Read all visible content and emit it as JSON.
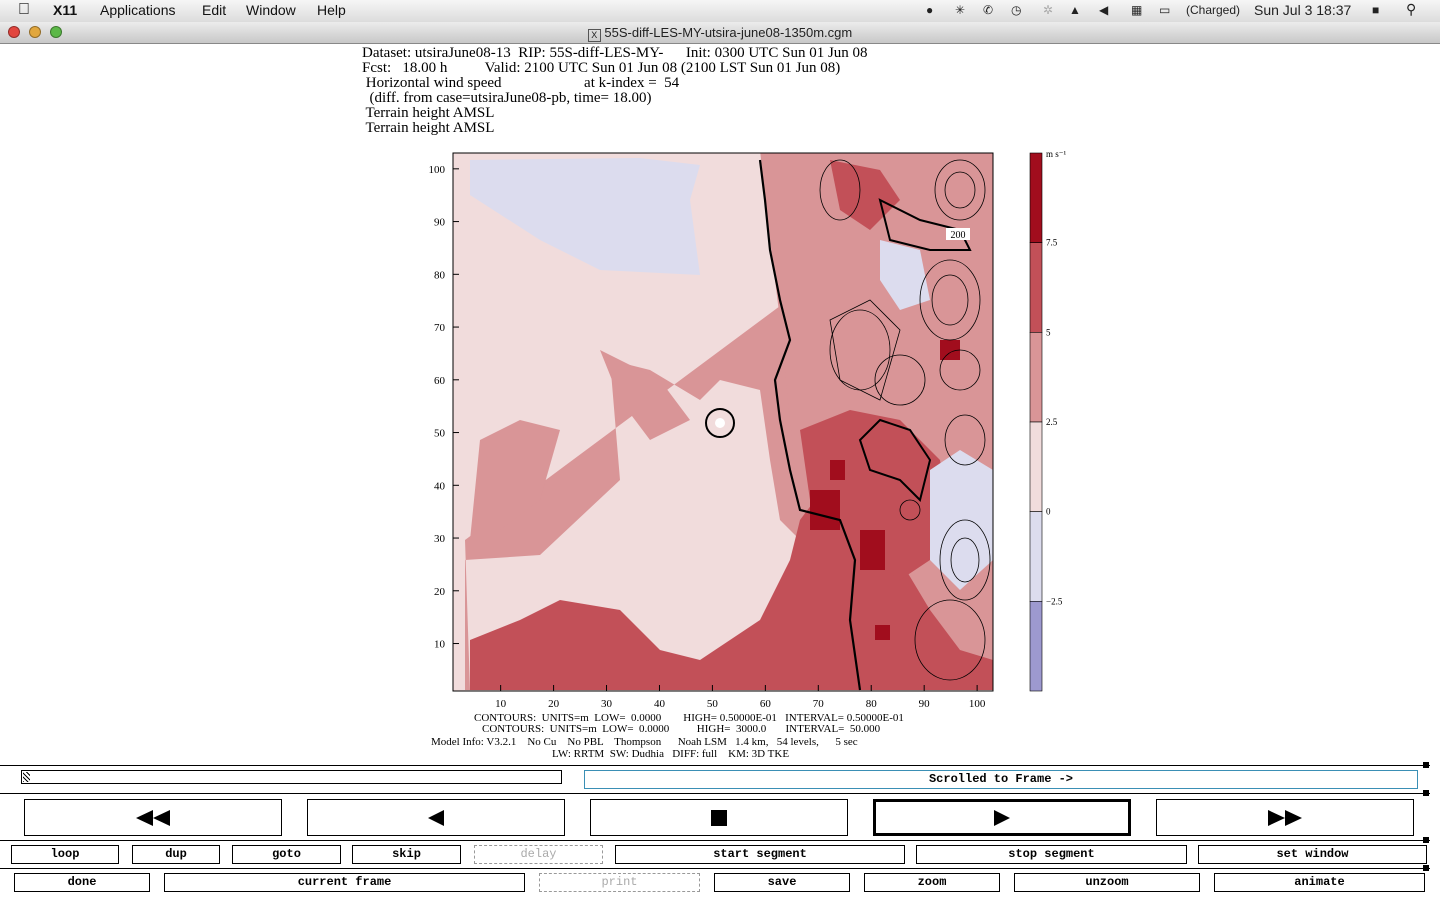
{
  "menubar": {
    "app": "X11",
    "items": [
      "Applications",
      "Edit",
      "Window",
      "Help"
    ],
    "battery": "(Charged)",
    "datetime": "Sun Jul 3  18:37"
  },
  "window": {
    "title": "55S-diff-LES-MY-utsira-june08-1350m.cgm"
  },
  "plot_header": {
    "line1": "Dataset: utsiraJune08-13  RIP: 55S-diff-LES-MY-      Init: 0300 UTC Sun 01 Jun 08",
    "line2": "Fcst:   18.00 h          Valid: 2100 UTC Sun 01 Jun 08 (2100 LST Sun 01 Jun 08)",
    "line3": " Horizontal wind speed                      at k-index =  54",
    "line4": "  (diff. from case=utsiraJune08-pb, time= 18.00)",
    "line5": " Terrain height AMSL",
    "line6": " Terrain height AMSL"
  },
  "plot_footer": {
    "line1": "CONTOURS:  UNITS=m  LOW=  0.0000        HIGH= 0.50000E-01   INTERVAL= 0.50000E-01",
    "line2": "CONTOURS:  UNITS=m  LOW=  0.0000          HIGH=  3000.0       INTERVAL=  50.000",
    "line3": "Model Info: V3.2.1    No Cu    No PBL    Thompson      Noah LSM   1.4 km,   54 levels,      5 sec",
    "line4": "LW: RRTM  SW: Dudhia   DIFF: full    KM: 3D TKE"
  },
  "chart_data": {
    "type": "heatmap",
    "title": "Horizontal wind speed",
    "xlim": [
      1,
      103
    ],
    "ylim": [
      1,
      103
    ],
    "x_ticks": [
      "10",
      "20",
      "30",
      "40",
      "50",
      "60",
      "70",
      "80",
      "90",
      "100"
    ],
    "y_ticks": [
      "10",
      "20",
      "30",
      "40",
      "50",
      "60",
      "70",
      "80",
      "90",
      "100"
    ],
    "colorbar": {
      "units": "m s⁻¹",
      "tick_labels": [
        "7.5",
        "5",
        "2.5",
        "0",
        "−2.5"
      ],
      "levels": [
        {
          "range": "> 7.5",
          "color": "#a10d1d"
        },
        {
          "range": "5 to 7.5",
          "color": "#c25058"
        },
        {
          "range": "2.5 to 5",
          "color": "#d99597"
        },
        {
          "range": "0 to 2.5",
          "color": "#f1dcdc"
        },
        {
          "range": "-2.5 to 0",
          "color": "#dcdcee"
        },
        {
          "range": "< -2.5",
          "color": "#9d99cf"
        }
      ]
    },
    "contour_label": "200"
  },
  "controls": {
    "frame_status": "Scrolled to Frame ->",
    "row1": [
      "loop",
      "dup",
      "goto",
      "skip",
      "delay",
      "start segment",
      "stop segment",
      "set window"
    ],
    "row2": [
      "done",
      "current frame",
      "print",
      "save",
      "zoom",
      "unzoom",
      "animate"
    ]
  }
}
